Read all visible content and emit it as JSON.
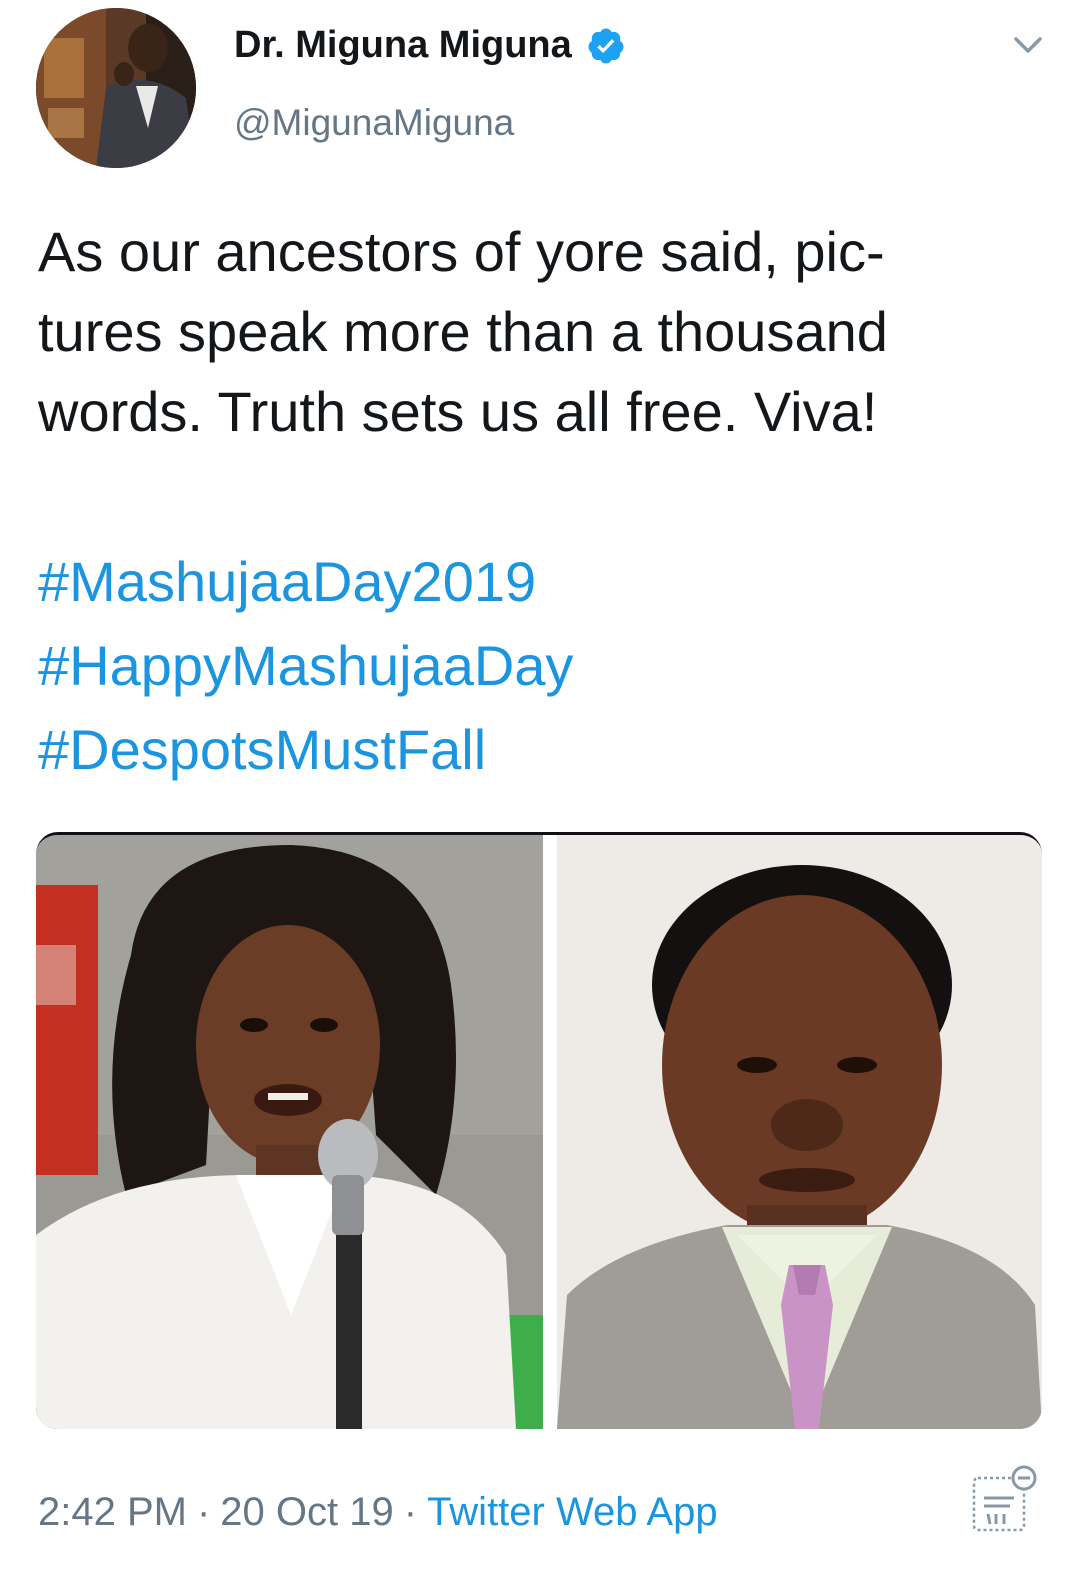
{
  "author": {
    "display_name": "Dr. Miguna Miguna",
    "handle": "@MigunaMiguna",
    "verified": true
  },
  "tweet": {
    "text_lines": [
      "As our ancestors of yore said, pic-",
      "tures speak more than a thousand",
      "words. Truth sets us all free. Viva!"
    ],
    "hashtags": [
      "#MashujaaDay2019",
      "#HappyMashujaaDay",
      "#DespotsMustFall"
    ]
  },
  "meta": {
    "time": "2:42 PM",
    "separator": "·",
    "date": "20 Oct 19",
    "source": "Twitter Web App"
  },
  "icons": {
    "verified": "verified-badge-icon",
    "caret": "chevron-down-icon",
    "analytics": "tweet-activity-icon"
  },
  "colors": {
    "link": "#1b95e0",
    "secondary_text": "#657786",
    "primary_text": "#14171a",
    "verified": "#1da1f2"
  }
}
